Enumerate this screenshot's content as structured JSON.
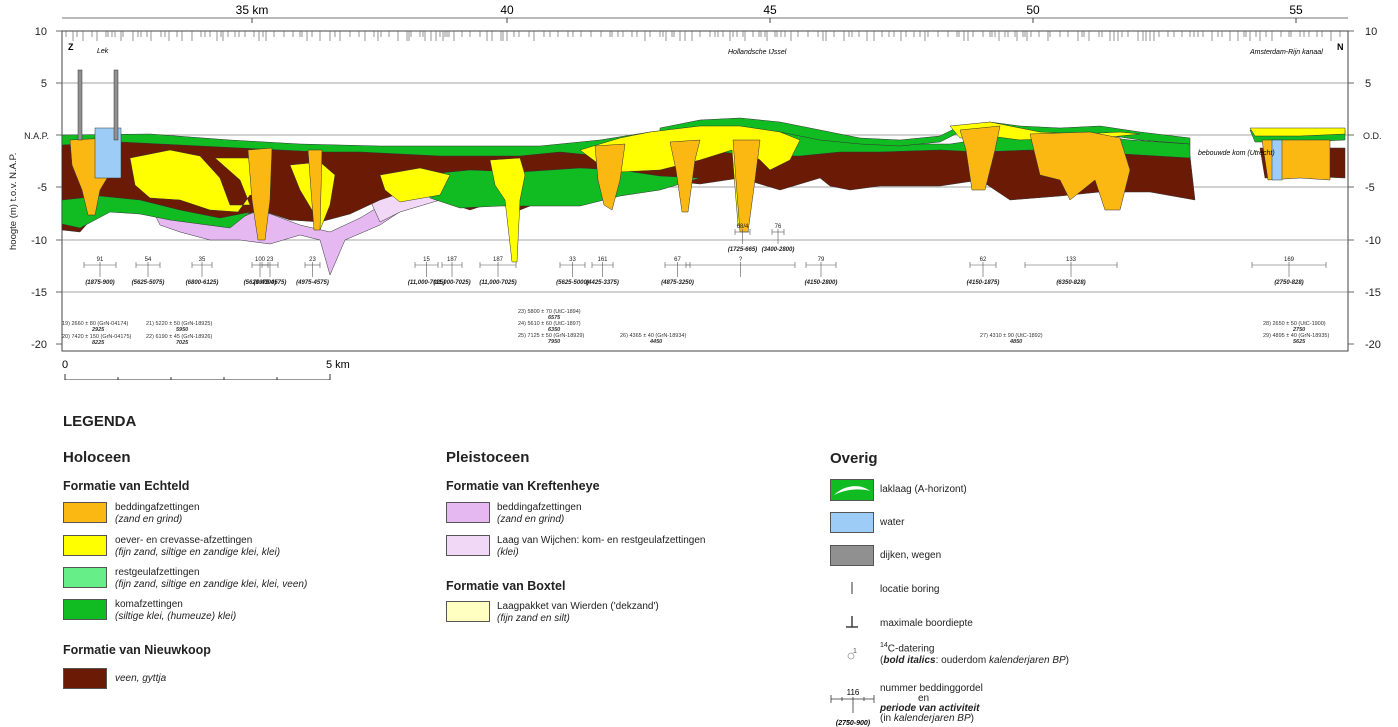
{
  "section": {
    "km_ticks": [
      "35 km",
      "40",
      "45",
      "50",
      "55"
    ],
    "y_ticks": [
      "10",
      "5",
      "N.A.P.",
      "-5",
      "-10",
      "-15",
      "-20"
    ],
    "y_ticks_right": [
      "10",
      "5",
      "O.D.",
      "-5",
      "-10",
      "-15",
      "-20"
    ],
    "y_axis_label": "hoogte (m) t.o.v. N.A.P.",
    "end_left": "Z",
    "end_right": "N",
    "place_labels": [
      {
        "id": "lek",
        "text": "Lek"
      },
      {
        "id": "ijssel",
        "text": "Hollandsche IJssel"
      },
      {
        "id": "ark",
        "text": "Amsterdam-Rijn kanaal"
      },
      {
        "id": "utrecht",
        "text": "bebouwde kom (Utrecht)"
      }
    ],
    "belts": [
      {
        "num": "91",
        "age": "(1875-900)"
      },
      {
        "num": "54",
        "age": "(5625-5075)"
      },
      {
        "num": "35",
        "age": "(6800-6125)"
      },
      {
        "num": "100",
        "age": "(5625-4300)"
      },
      {
        "num": "23",
        "age": "(4975-4575)"
      },
      {
        "num": "23",
        "age": "(4975-4575)"
      },
      {
        "num": "15",
        "age": "(11,000-7025)"
      },
      {
        "num": "187",
        "age": "(11,000-7025)"
      },
      {
        "num": "187",
        "age": "(11,000-7025)"
      },
      {
        "num": "33",
        "age": "(5625-5000)"
      },
      {
        "num": "161",
        "age": "(4425-3375)"
      },
      {
        "num": "67",
        "age": "(4875-3250)"
      },
      {
        "num": "?",
        "age": ""
      },
      {
        "num": "79",
        "age": "(4150-2800)"
      },
      {
        "num": "62",
        "age": "(4150-1875)"
      },
      {
        "num": "133",
        "age": "(6350-828)"
      },
      {
        "num": "169",
        "age": "(2750-828)"
      },
      {
        "num": "68/4",
        "age": "(1725-665)"
      },
      {
        "num": "76",
        "age": "(3400-2800)"
      }
    ],
    "datings": [
      {
        "line": "19) 2660 ± 80 (GrN-04174)",
        "age": "2925"
      },
      {
        "line": "20) 7420 ± 150 (GrN-04175)",
        "age": "8225"
      },
      {
        "line": "21) 5220 ± 50 (GrN-18925)",
        "age": "5950"
      },
      {
        "line": "22) 6190 ± 45 (GrN-18926)",
        "age": "7025"
      },
      {
        "line": "23) 5800 ± 70 (UtC-1894)",
        "age": "6575"
      },
      {
        "line": "24) 5610 ± 60 (UtC-1897)",
        "age": "6350"
      },
      {
        "line": "25) 7125 ± 50 (GrN-18929)",
        "age": "7950"
      },
      {
        "line": "26) 4365 ± 40 (GrN-18934)",
        "age": "4450"
      },
      {
        "line": "27) 4310 ± 90 (UtC-1892)",
        "age": "4850"
      },
      {
        "line": "28) 2650 ± 50 (UtC-1900)",
        "age": "2750"
      },
      {
        "line": "29) 4895 ± 40 (GrN-18935)",
        "age": "5625"
      }
    ],
    "scale_start": "0",
    "scale_end": "5 km"
  },
  "legend": {
    "title": "LEGENDA",
    "holoceen": {
      "title": "Holoceen",
      "echteld": {
        "title": "Formatie van Echteld",
        "items": [
          {
            "label": "beddingafzettingen",
            "sub": "(zand en grind)",
            "color": "#fbb812"
          },
          {
            "label": "oever- en crevasse-afzettingen",
            "sub": "(fijn zand, siltige en zandige klei, klei)",
            "color": "#ffff00"
          },
          {
            "label": "restgeulafzettingen",
            "sub": "(fijn zand, siltige en zandige klei, klei, veen)",
            "color": "#66ee88"
          },
          {
            "label": "komafzettingen",
            "sub": "(siltige klei, (humeuze) klei)",
            "color": "#11bb22"
          }
        ]
      },
      "nieuwkoop": {
        "title": "Formatie van Nieuwkoop",
        "items": [
          {
            "label": "veen, gyttja",
            "color": "#6b1a06"
          }
        ]
      }
    },
    "pleistoceen": {
      "title": "Pleistoceen",
      "kreftenheye": {
        "title": "Formatie van Kreftenheye",
        "items": [
          {
            "label": "beddingafzettingen",
            "sub": "(zand en grind)",
            "color": "#e6b8f2"
          },
          {
            "label": "Laag van Wijchen: kom- en restgeulafzettingen",
            "sub": "(klei)",
            "color": "#f2d8f7"
          }
        ]
      },
      "boxtel": {
        "title": "Formatie van Boxtel",
        "items": [
          {
            "label": "Laagpakket van Wierden ('dekzand')",
            "sub": "(fijn zand en silt)",
            "color": "#ffffc2"
          }
        ]
      }
    },
    "overig": {
      "title": "Overig",
      "items": [
        {
          "id": "laklaag",
          "label": "laklaag (A-horizont)"
        },
        {
          "id": "water",
          "label": "water",
          "color": "#9dcdf7"
        },
        {
          "id": "dijken",
          "label": "dijken, wegen",
          "color": "#909090"
        },
        {
          "id": "boring",
          "label": "locatie boring"
        },
        {
          "id": "boordiepte",
          "label": "maximale boordiepte"
        },
        {
          "id": "c14",
          "sup": "14",
          "label": "C-datering",
          "sub_bold": "bold italics",
          "sub_rest": ": ouderdom ",
          "sub_italic": "kalenderjaren BP",
          "marker": "1"
        },
        {
          "id": "gordel",
          "label": "nummer beddinggordel",
          "en": "en",
          "label2": "periode van activiteit",
          "label3": "(in ",
          "label3_italic": "kalenderjaren BP",
          "label3_end": ")",
          "sym_num": "116",
          "sym_age": "(2750-900)"
        }
      ]
    }
  }
}
